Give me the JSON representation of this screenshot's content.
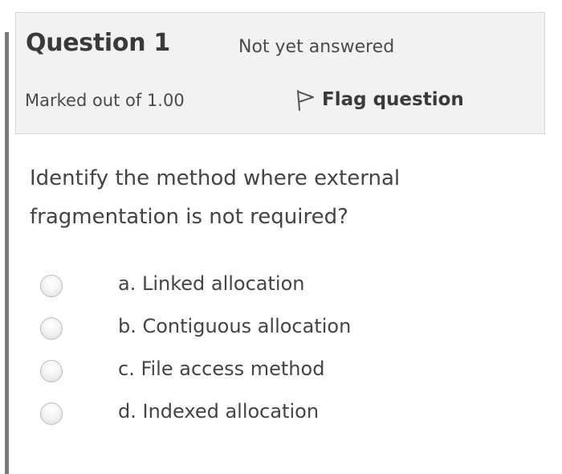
{
  "info": {
    "question_title": "Question 1",
    "state": "Not yet answered",
    "grade": "Marked out of 1.00",
    "flag_label": "Flag question"
  },
  "question": {
    "text": "Identify the method where external fragmentation is not required?"
  },
  "answers": [
    {
      "label": "a. Linked allocation",
      "selected": false
    },
    {
      "label": "b. Contiguous allocation",
      "selected": false
    },
    {
      "label": "c. File access method",
      "selected": false
    },
    {
      "label": "d. Indexed allocation",
      "selected": false
    }
  ],
  "icons": {
    "flag": "flag-outline-icon",
    "radio": "radio-unchecked-icon"
  },
  "colors": {
    "info_background": "#f2f2f2",
    "left_rule": "#7a7a7a",
    "text": "#3a3a3a"
  }
}
